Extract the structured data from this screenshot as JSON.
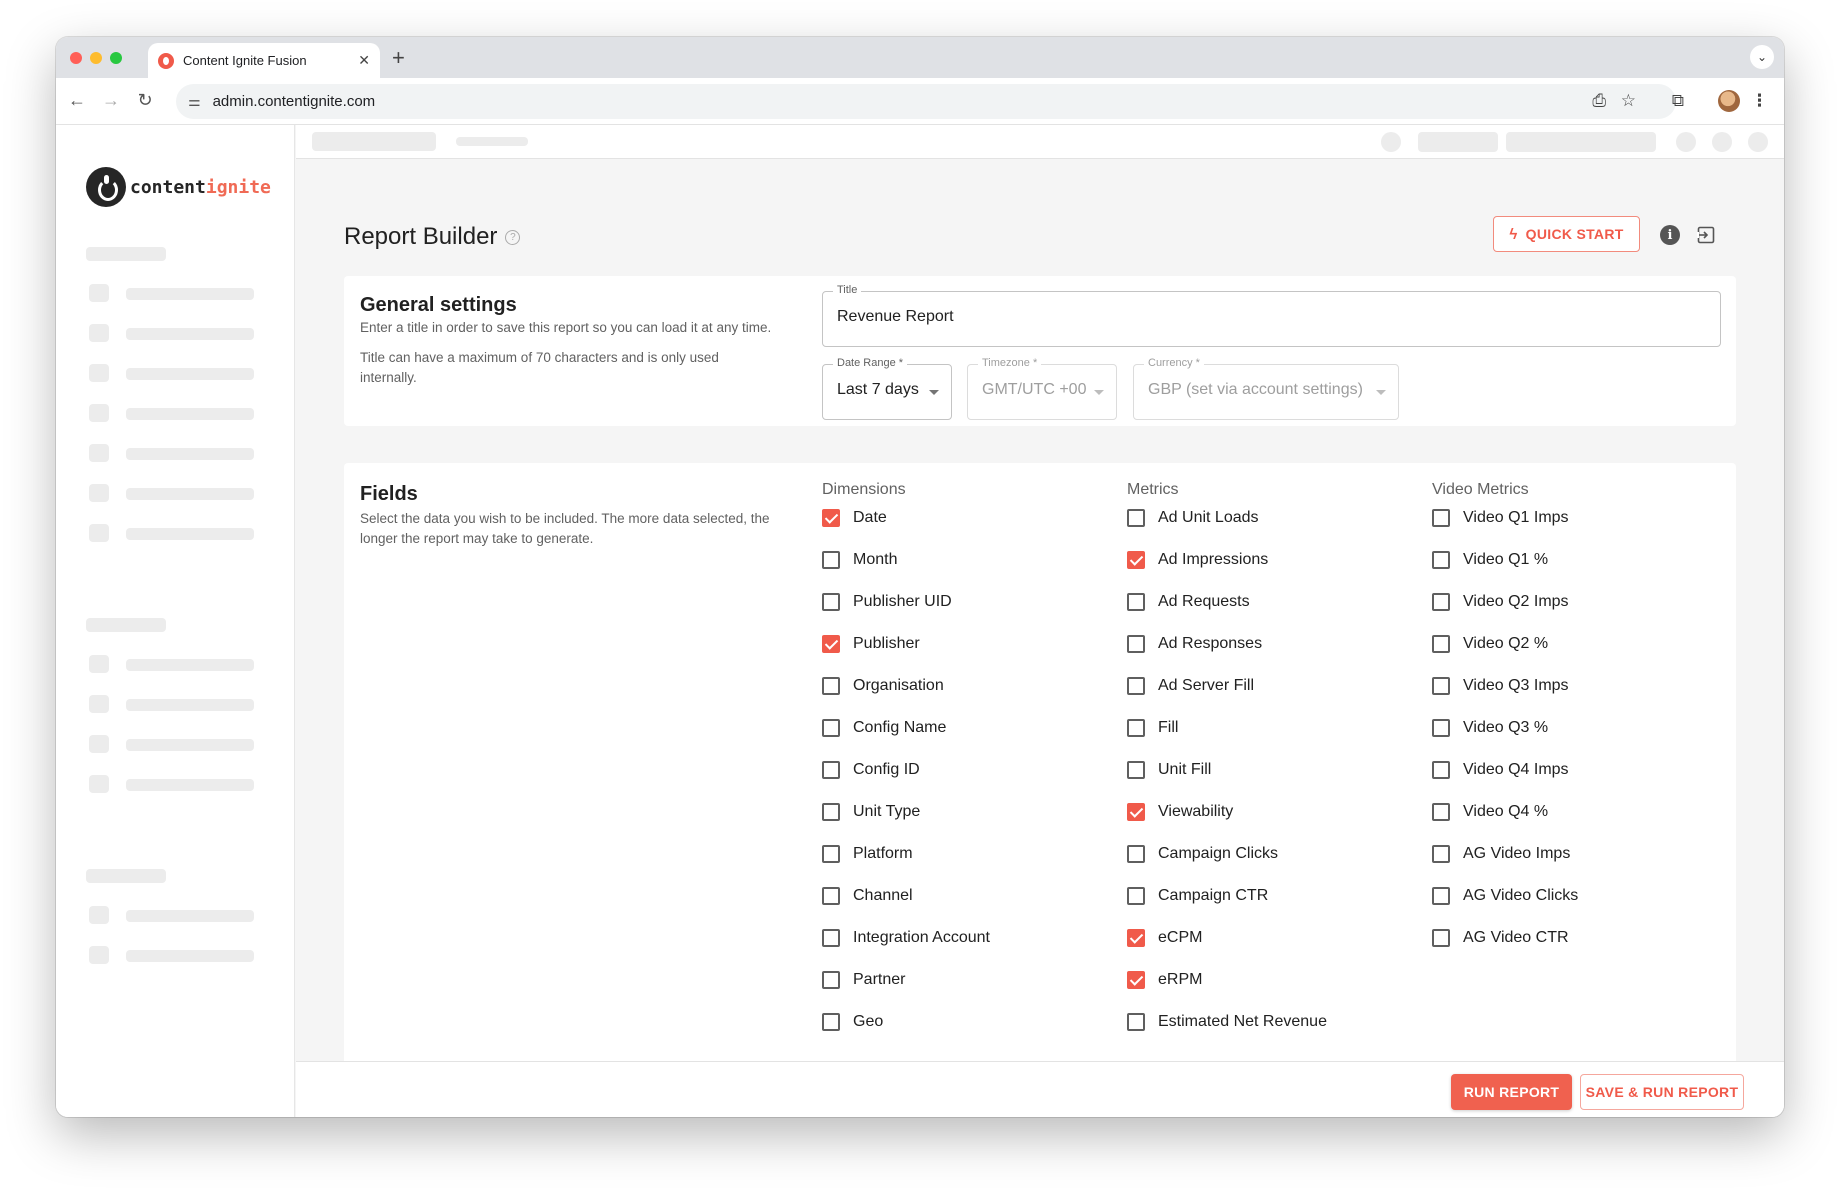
{
  "browser": {
    "tab_title": "Content Ignite Fusion",
    "tab_close": "✕",
    "new_tab": "+",
    "url": "admin.contentignite.com",
    "traffic_lights": [
      "#ff5f57",
      "#febc2e",
      "#28c840"
    ]
  },
  "logo": {
    "part1": "content",
    "part2": "ignite",
    "mark": "®"
  },
  "header": {
    "title": "Report Builder",
    "quick_start": "QUICK START",
    "info": "i"
  },
  "general": {
    "title": "General settings",
    "desc1": "Enter a title in order to save this report so you can load it at any time.",
    "desc2": "Title can have a maximum of 70 characters and is only used internally.",
    "title_field": {
      "label": "Title",
      "value": "Revenue Report"
    },
    "date_range": {
      "label": "Date Range *",
      "value": "Last 7 days"
    },
    "timezone": {
      "label": "Timezone *",
      "value": "GMT/UTC +00"
    },
    "currency": {
      "label": "Currency *",
      "value": "GBP (set via account settings)"
    }
  },
  "fields": {
    "title": "Fields",
    "desc": "Select the data you wish to be included. The more data selected, the longer the report may take to generate.",
    "dimensions": {
      "heading": "Dimensions",
      "items": [
        {
          "label": "Date",
          "checked": true
        },
        {
          "label": "Month",
          "checked": false
        },
        {
          "label": "Publisher UID",
          "checked": false
        },
        {
          "label": "Publisher",
          "checked": true
        },
        {
          "label": "Organisation",
          "checked": false
        },
        {
          "label": "Config Name",
          "checked": false
        },
        {
          "label": "Config ID",
          "checked": false
        },
        {
          "label": "Unit Type",
          "checked": false
        },
        {
          "label": "Platform",
          "checked": false
        },
        {
          "label": "Channel",
          "checked": false
        },
        {
          "label": "Integration Account",
          "checked": false
        },
        {
          "label": "Partner",
          "checked": false
        },
        {
          "label": "Geo",
          "checked": false
        }
      ]
    },
    "metrics": {
      "heading": "Metrics",
      "items": [
        {
          "label": "Ad Unit Loads",
          "checked": false
        },
        {
          "label": "Ad Impressions",
          "checked": true
        },
        {
          "label": "Ad Requests",
          "checked": false
        },
        {
          "label": "Ad Responses",
          "checked": false
        },
        {
          "label": "Ad Server Fill",
          "checked": false
        },
        {
          "label": "Fill",
          "checked": false
        },
        {
          "label": "Unit Fill",
          "checked": false
        },
        {
          "label": "Viewability",
          "checked": true
        },
        {
          "label": "Campaign Clicks",
          "checked": false
        },
        {
          "label": "Campaign CTR",
          "checked": false
        },
        {
          "label": "eCPM",
          "checked": true
        },
        {
          "label": "eRPM",
          "checked": true
        },
        {
          "label": "Estimated Net Revenue",
          "checked": false
        }
      ]
    },
    "video_metrics": {
      "heading": "Video Metrics",
      "items": [
        {
          "label": "Video Q1 Imps",
          "checked": false
        },
        {
          "label": "Video Q1 %",
          "checked": false
        },
        {
          "label": "Video Q2 Imps",
          "checked": false
        },
        {
          "label": "Video Q2 %",
          "checked": false
        },
        {
          "label": "Video Q3 Imps",
          "checked": false
        },
        {
          "label": "Video Q3 %",
          "checked": false
        },
        {
          "label": "Video Q4 Imps",
          "checked": false
        },
        {
          "label": "Video Q4 %",
          "checked": false
        },
        {
          "label": "AG Video Imps",
          "checked": false
        },
        {
          "label": "AG Video Clicks",
          "checked": false
        },
        {
          "label": "AG Video CTR",
          "checked": false
        }
      ]
    }
  },
  "footer": {
    "run": "RUN REPORT",
    "save_run": "SAVE & RUN REPORT"
  },
  "colors": {
    "accent": "#f05a4a",
    "checkbox_border": "#5f5f5f",
    "page_bg": "#f5f5f5"
  }
}
